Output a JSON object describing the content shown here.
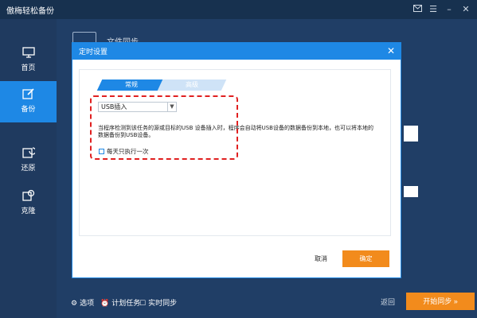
{
  "window": {
    "title": "傲梅轻松备份",
    "controls": [
      "mail-icon",
      "menu-icon",
      "minimize-icon",
      "close-icon"
    ]
  },
  "sidebar": {
    "items": [
      {
        "label": "首页",
        "icon": "monitor-icon",
        "active": false
      },
      {
        "label": "备份",
        "icon": "backup-edit-icon",
        "active": true
      },
      {
        "label": "还原",
        "icon": "restore-icon",
        "active": false
      },
      {
        "label": "克隆",
        "icon": "clone-icon",
        "active": false
      }
    ]
  },
  "main": {
    "title": "文件同步"
  },
  "bottom": {
    "options_label": "选项",
    "schedule_label": "计划任务",
    "realtime_label": "实时同步",
    "back_label": "返回",
    "start_label": "开始同步 »"
  },
  "dialog": {
    "title": "定时设置",
    "tabs": [
      {
        "label": "常规",
        "active": true
      },
      {
        "label": "高级",
        "active": false
      }
    ],
    "trigger_select": {
      "value": "USB插入"
    },
    "description": "当程序检测到该任务的源或目标的USB 设备插入时，程序会自动将USB设备的数据备份到本地，也可以将本地的数据备份到USB设备。",
    "checkbox_label": "每天只执行一次",
    "cancel_label": "取消",
    "ok_label": "确定"
  },
  "colors": {
    "accent": "#1e88e5",
    "orange": "#f28b1c",
    "sidebar": "#1f3a5f",
    "highlight": "#e02020"
  }
}
